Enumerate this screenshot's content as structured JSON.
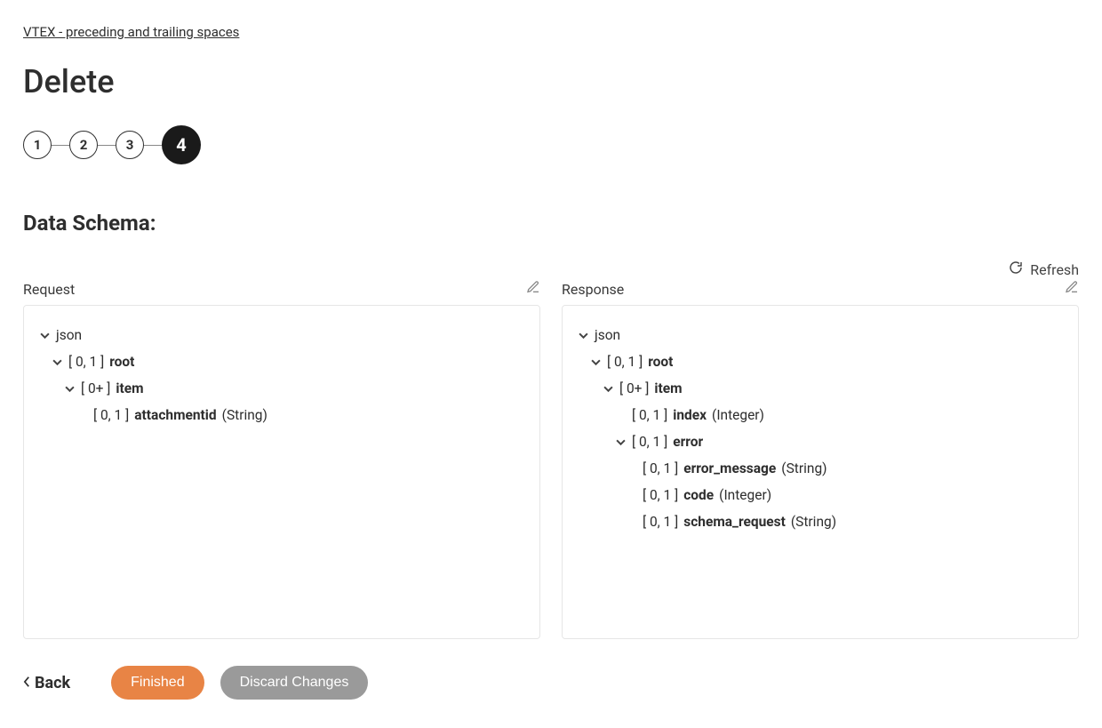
{
  "breadcrumb": "VTEX - preceding and trailing spaces",
  "page_title": "Delete",
  "steps": [
    "1",
    "2",
    "3",
    "4"
  ],
  "active_step_index": 3,
  "section_title": "Data Schema:",
  "refresh_label": "Refresh",
  "request": {
    "label": "Request",
    "tree": {
      "root_label": "json",
      "n0_card": "[ 0, 1 ]",
      "n0_name": "root",
      "n1_card": "[ 0+ ]",
      "n1_name": "item",
      "n2_card": "[ 0, 1 ]",
      "n2_name": "attachmentid",
      "n2_type": "(String)"
    }
  },
  "response": {
    "label": "Response",
    "tree": {
      "root_label": "json",
      "n0_card": "[ 0, 1 ]",
      "n0_name": "root",
      "n1_card": "[ 0+ ]",
      "n1_name": "item",
      "n2_card": "[ 0, 1 ]",
      "n2_name": "index",
      "n2_type": "(Integer)",
      "n3_card": "[ 0, 1 ]",
      "n3_name": "error",
      "n4_card": "[ 0, 1 ]",
      "n4_name": "error_message",
      "n4_type": "(String)",
      "n5_card": "[ 0, 1 ]",
      "n5_name": "code",
      "n5_type": "(Integer)",
      "n6_card": "[ 0, 1 ]",
      "n6_name": "schema_request",
      "n6_type": "(String)"
    }
  },
  "footer": {
    "back": "Back",
    "finished": "Finished",
    "discard": "Discard Changes"
  }
}
